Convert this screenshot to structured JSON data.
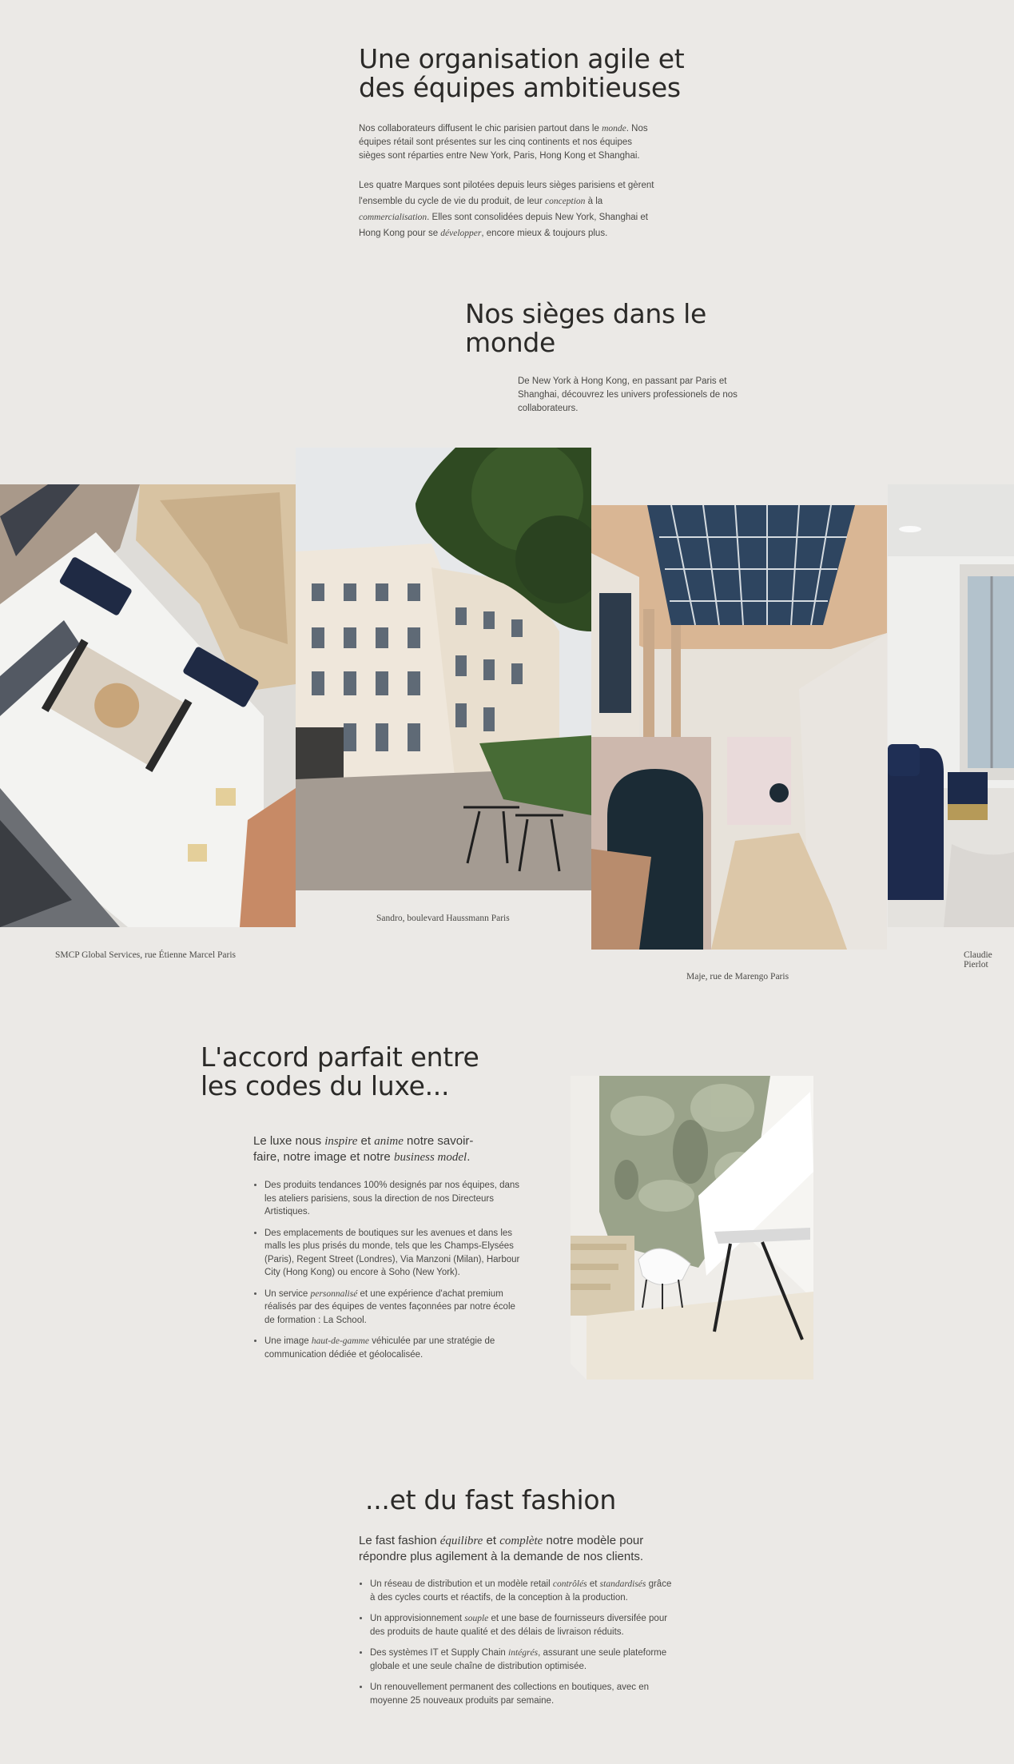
{
  "org": {
    "title_line1": "Une organisation agile et",
    "title_line2": "des équipes ambitieuses",
    "p1_a": "Nos collaborateurs diffusent le chic parisien partout dans le ",
    "p1_em": "monde",
    "p1_b": ". Nos équipes rétail sont présentes sur les cinq continents et nos équipes sièges sont réparties entre New York, Paris, Hong Kong et Shanghai.",
    "p2_a": "Les quatre Marques sont pilotées depuis leurs sièges parisiens et gèrent l'ensemble du cycle de vie du produit, de leur ",
    "p2_em1": "conception",
    "p2_b": " à la ",
    "p2_em2": "commercialisation",
    "p2_c": ". Elles sont consolidées depuis New York, Shanghai et Hong Kong pour se ",
    "p2_em3": "développer",
    "p2_d": ", encore mieux & toujours plus."
  },
  "sieges": {
    "title_line1": "Nos sièges dans le",
    "title_line2": "monde",
    "intro": "De New York à Hong Kong, en passant par Paris et Shanghai, découvrez les univers professionels de nos collaborateurs."
  },
  "gallery": {
    "captions": [
      "SMCP Global Services, rue Étienne Marcel Paris",
      "Sandro, boulevard Haussmann Paris",
      "Maje, rue de Marengo Paris",
      "Claudie Pierlot"
    ]
  },
  "luxe": {
    "title_line1": "L'accord parfait entre",
    "title_line2": "les codes du luxe...",
    "lead_a": "Le luxe nous ",
    "lead_em1": "inspire",
    "lead_b": " et ",
    "lead_em2": "anime",
    "lead_c": " notre savoir-faire, notre image et notre ",
    "lead_em3": "business model",
    "lead_d": ".",
    "b1": "Des produits tendances 100% designés par nos équipes, dans les ateliers parisiens, sous la direction de nos Directeurs Artistiques.",
    "b2": "Des emplacements de boutiques sur les avenues et dans les malls les plus prisés du monde, tels que les Champs-Elysées (Paris), Regent Street (Londres), Via Manzoni (Milan), Harbour City (Hong Kong) ou encore à Soho (New York).",
    "b3_a": "Un service ",
    "b3_em": "personnalisé",
    "b3_b": " et une expérience d'achat premium réalisés par des équipes de ventes façonnées par notre école de formation : La School.",
    "b4_a": "Une image ",
    "b4_em": "haut-de-gamme",
    "b4_b": " véhiculée par une stratégie de communication dédiée et géolocalisée."
  },
  "fast": {
    "title": "...et du fast fashion",
    "lead_a": "Le fast fashion ",
    "lead_em1": "équilibre",
    "lead_b": " et ",
    "lead_em2": "complète",
    "lead_c": " notre modèle pour répondre plus agilement à la demande de nos clients.",
    "b1_a": "Un réseau de distribution et un modèle retail ",
    "b1_em1": "contrôlés",
    "b1_b": " et ",
    "b1_em2": "standardisés",
    "b1_c": " grâce à des cycles courts et réactifs, de la conception à la production.",
    "b2_a": "Un approvisionnement ",
    "b2_em": "souple",
    "b2_b": " et une base de fournisseurs diversifée pour des produits de haute qualité et des délais de livraison réduits.",
    "b3_a": "Des systèmes IT et Supply Chain ",
    "b3_em": "intégrés",
    "b3_b": ", assurant une seule plateforme globale et une seule chaîne de distribution optimisée.",
    "b4": "Un renouvellement permanent des collections en boutiques, avec en moyenne 25 nouveaux produits par semaine."
  }
}
